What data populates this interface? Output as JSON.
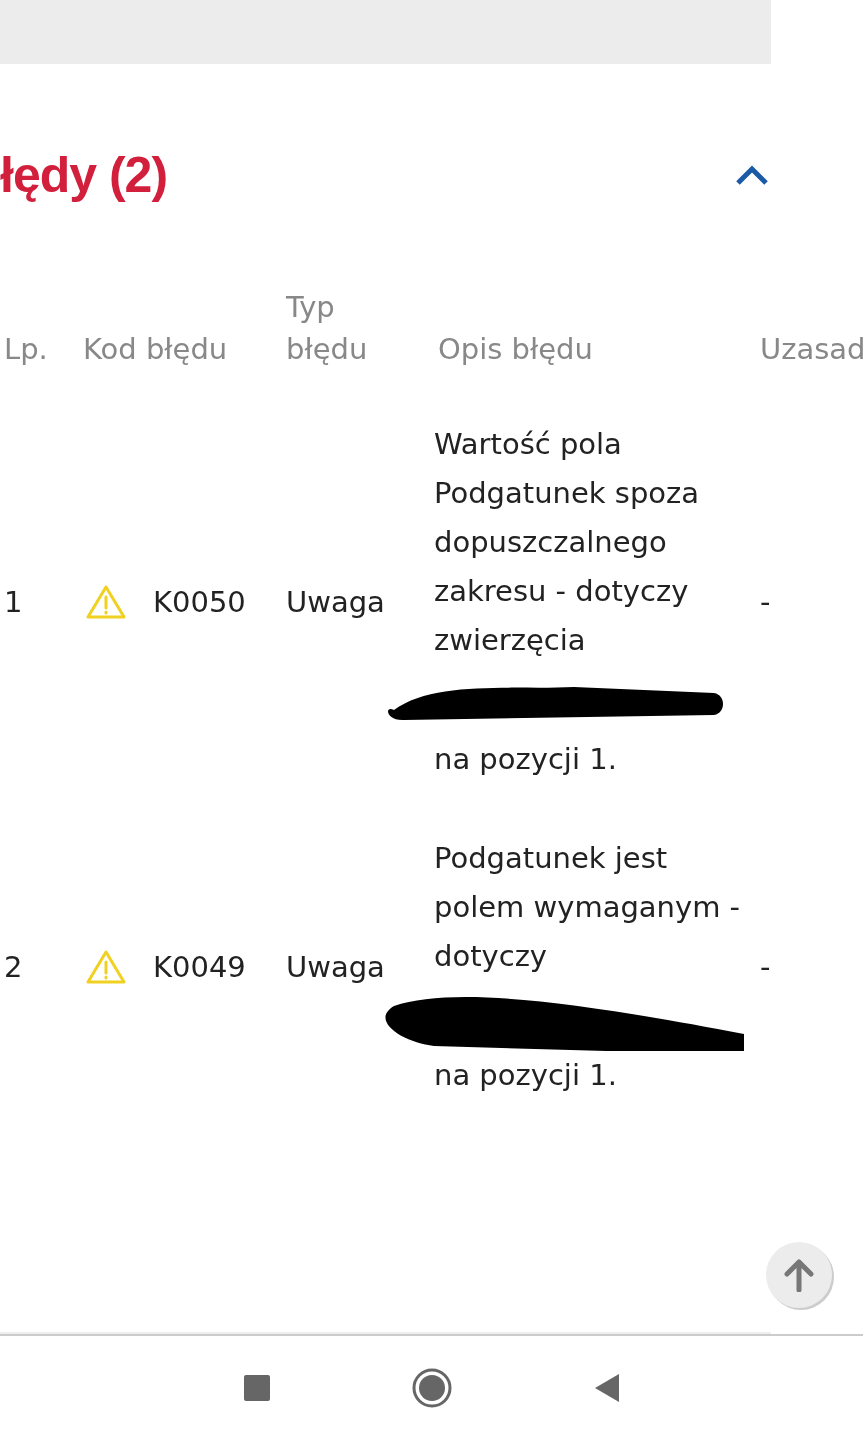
{
  "section": {
    "title": "łędy (2)",
    "expanded": true
  },
  "table": {
    "columns": [
      "Lp.",
      "Kod błędu",
      "Typ\nbłędu",
      "Opis błędu",
      "Uzasad"
    ],
    "rows": [
      {
        "number": "1",
        "code": "K0050",
        "type": "Uwaga",
        "description": "Wartość pola Podgatunek spoza dopuszczalnego zakresu - dotyczy zwierzęcia",
        "description_end": "na pozycji 1.",
        "justification": "-"
      },
      {
        "number": "2",
        "code": "K0049",
        "type": "Uwaga",
        "description": "Podgatunek jest polem wymaganym - dotyczy",
        "description_end": "na pozycji 1.",
        "justification": "-"
      }
    ]
  }
}
